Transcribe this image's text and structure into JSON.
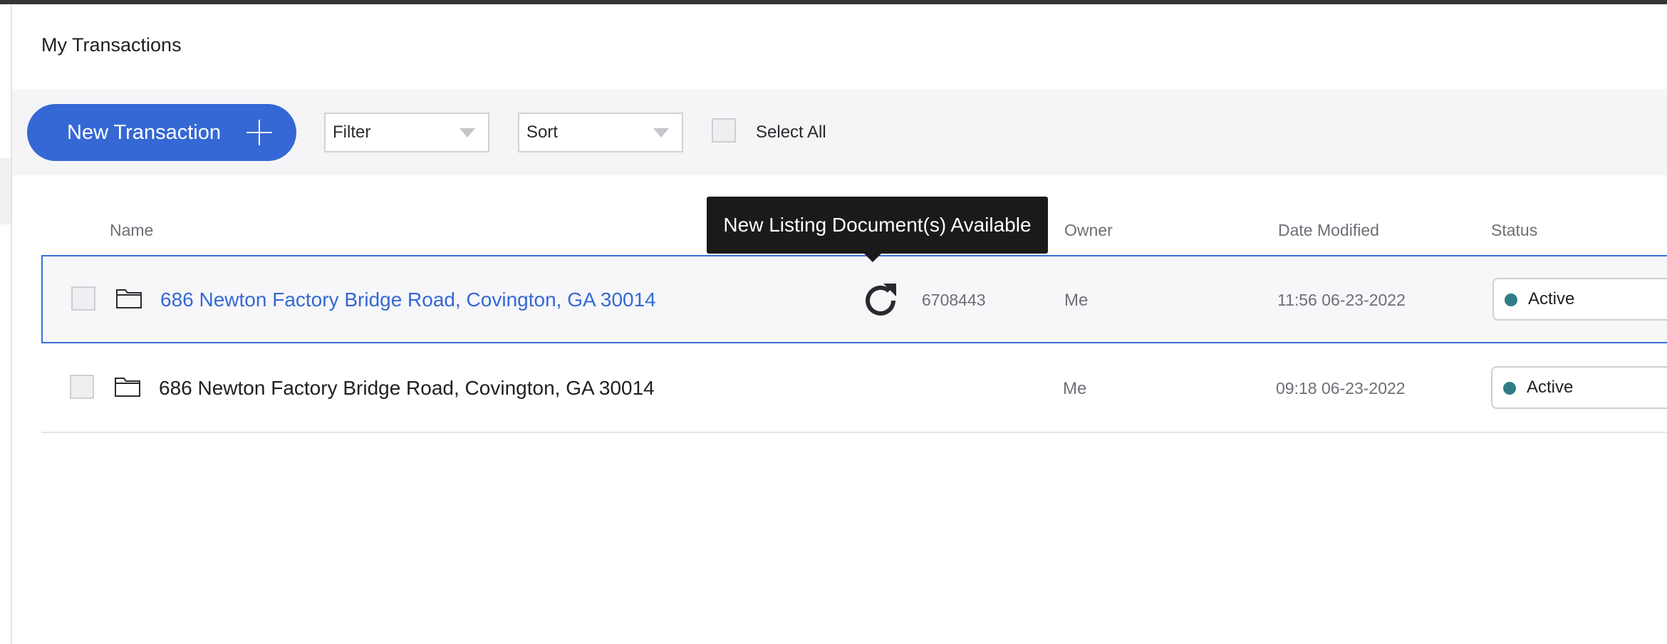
{
  "page": {
    "title": "My Transactions"
  },
  "toolbar": {
    "new_transaction_label": "New Transaction",
    "filter_label": "Filter",
    "sort_label": "Sort",
    "select_all_label": "Select All"
  },
  "table": {
    "headers": {
      "name": "Name",
      "owner": "Owner",
      "date_modified": "Date Modified",
      "status": "Status"
    },
    "rows": [
      {
        "name": "686 Newton Factory Bridge Road, Covington, GA 30014",
        "id": "6708443",
        "owner": "Me",
        "date_modified": "11:56 06-23-2022",
        "status": "Active",
        "selected": true
      },
      {
        "name": "686 Newton Factory Bridge Road, Covington, GA 30014",
        "id": "",
        "owner": "Me",
        "date_modified": "09:18 06-23-2022",
        "status": "Active",
        "selected": false
      }
    ]
  },
  "tooltip": {
    "text": "New Listing Document(s) Available"
  },
  "icons": [
    "plus-icon",
    "chevron-down-icon",
    "folder-icon",
    "refresh-icon",
    "status-dot-icon"
  ],
  "colors": {
    "primary": "#3568d4",
    "status_active": "#2e7d85",
    "tooltip_bg": "#1a1a1a"
  }
}
